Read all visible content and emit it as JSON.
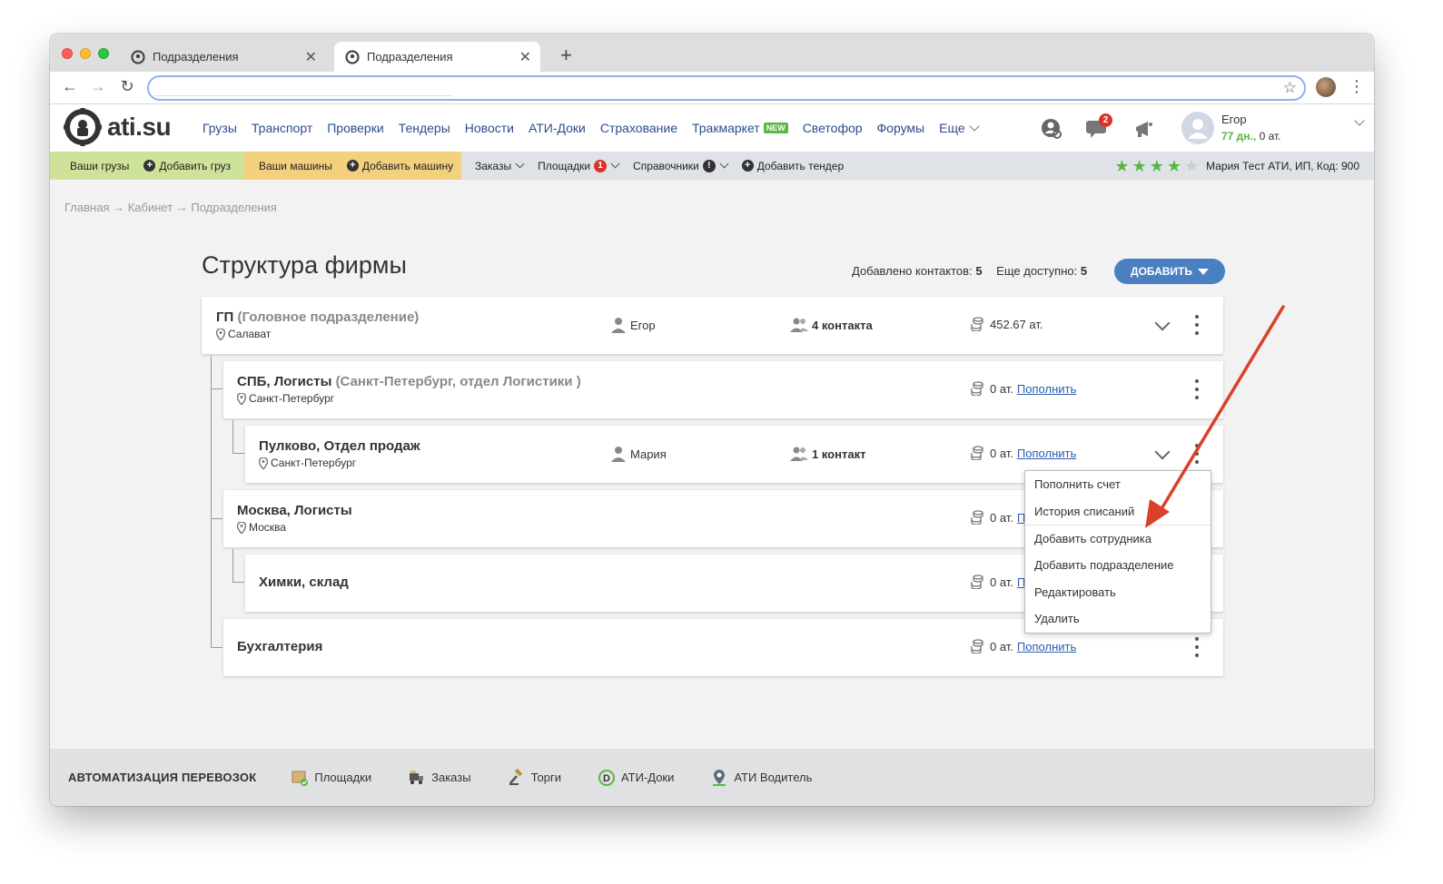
{
  "browser": {
    "tabs": [
      {
        "title": "Подразделения"
      },
      {
        "title": "Подразделения"
      }
    ],
    "new_tab": "+",
    "address": ""
  },
  "header": {
    "logo": "ati.su",
    "nav": [
      "Грузы",
      "Транспорт",
      "Проверки",
      "Тендеры",
      "Новости",
      "АТИ-Доки",
      "Страхование",
      "Тракмаркет",
      "Светофор",
      "Форумы",
      "Еще"
    ],
    "new_badge": "NEW",
    "messages_count": "2",
    "user": {
      "name": "Егор",
      "days": "77 дн.,",
      "balance": "0 ат."
    }
  },
  "subbar": {
    "my_loads": "Ваши грузы",
    "add_load": "Добавить груз",
    "my_trucks": "Ваши машины",
    "add_truck": "Добавить машину",
    "orders": "Заказы",
    "platforms": "Площадки",
    "platforms_count": "1",
    "references": "Справочники",
    "references_mark": "!",
    "add_tender": "Добавить тендер",
    "rating_stars": 4,
    "rating_max": 5,
    "company": "Мария Тест АТИ, ИП,  Код: 900",
    "colors": {
      "green": "#cfe29a",
      "yellow": "#f2d07d",
      "star": "#5bb543"
    }
  },
  "breadcrumb": "Главная → Кабинет → Подразделения",
  "page": {
    "title": "Структура фирмы",
    "added_label": "Добавлено контактов:",
    "added_value": "5",
    "available_label": "Еще доступно:",
    "available_value": "5",
    "add_button": "ДОБАВИТЬ"
  },
  "departments": [
    {
      "name": "ГП",
      "sub": "(Головное подразделение)",
      "city": "Салават",
      "person": "Егор",
      "contacts": "4 контакта",
      "balance": "452.67 ат.",
      "topup": ""
    },
    {
      "name": "СПБ, Логисты",
      "sub": "(Санкт-Петербург, отдел Логистики )",
      "city": "Санкт-Петербург",
      "person": "",
      "contacts": "",
      "balance": "0 ат.",
      "topup": "Пополнить"
    },
    {
      "name": "Пулково, Отдел продаж",
      "sub": "",
      "city": "Санкт-Петербург",
      "person": "Мария",
      "contacts": "1 контакт",
      "balance": "0 ат.",
      "topup": "Пополнить"
    },
    {
      "name": "Москва, Логисты",
      "sub": "",
      "city": "Москва",
      "person": "",
      "contacts": "",
      "balance": "0 ат.",
      "topup": "П"
    },
    {
      "name": "Химки, склад",
      "sub": "",
      "city": "",
      "person": "",
      "contacts": "",
      "balance": "0 ат.",
      "topup": "П"
    },
    {
      "name": "Бухгалтерия",
      "sub": "",
      "city": "",
      "person": "",
      "contacts": "",
      "balance": "0 ат.",
      "topup": "Пополнить"
    }
  ],
  "menu": [
    "Пополнить счет",
    "История списаний",
    "Добавить сотрудника",
    "Добавить подразделение",
    "Редактировать",
    "Удалить"
  ],
  "footer": {
    "title": "АВТОМАТИЗАЦИЯ ПЕРЕВОЗОК",
    "items": [
      "Площадки",
      "Заказы",
      "Торги",
      "АТИ-Доки",
      "АТИ Водитель"
    ]
  },
  "annotation_color": "#d9412b"
}
